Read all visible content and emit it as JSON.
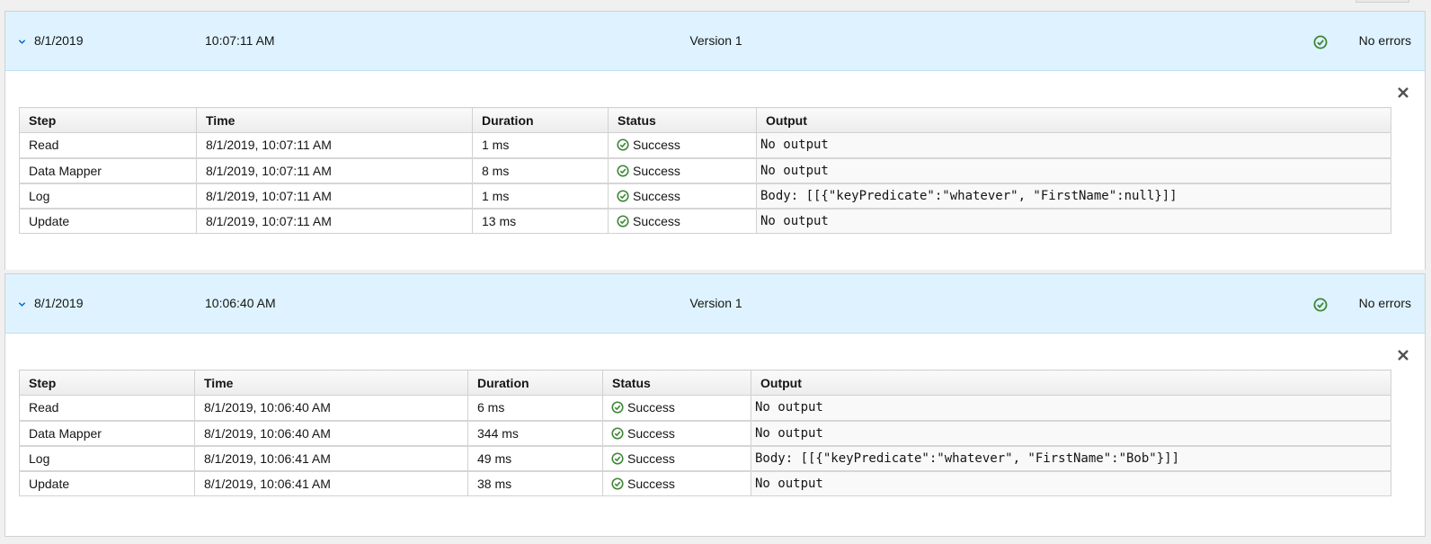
{
  "runs": [
    {
      "date": "8/1/2019",
      "time": "10:07:11 AM",
      "version": "Version 1",
      "status": "No errors",
      "columns": [
        "Step",
        "Time",
        "Duration",
        "Status",
        "Output"
      ],
      "steps": [
        {
          "step": "Read",
          "time": "8/1/2019, 10:07:11 AM",
          "duration": "1 ms",
          "status": "Success",
          "output": "No output"
        },
        {
          "step": "Data Mapper",
          "time": "8/1/2019, 10:07:11 AM",
          "duration": "8 ms",
          "status": "Success",
          "output": "No output"
        },
        {
          "step": "Log",
          "time": "8/1/2019, 10:07:11 AM",
          "duration": "1 ms",
          "status": "Success",
          "output": "Body: [[{\"keyPredicate\":\"whatever\", \"FirstName\":null}]]"
        },
        {
          "step": "Update",
          "time": "8/1/2019, 10:07:11 AM",
          "duration": "13 ms",
          "status": "Success",
          "output": "No output"
        }
      ]
    },
    {
      "date": "8/1/2019",
      "time": "10:06:40 AM",
      "version": "Version 1",
      "status": "No errors",
      "columns": [
        "Step",
        "Time",
        "Duration",
        "Status",
        "Output"
      ],
      "steps": [
        {
          "step": "Read",
          "time": "8/1/2019, 10:06:40 AM",
          "duration": "6 ms",
          "status": "Success",
          "output": "No output"
        },
        {
          "step": "Data Mapper",
          "time": "8/1/2019, 10:06:40 AM",
          "duration": "344 ms",
          "status": "Success",
          "output": "No output"
        },
        {
          "step": "Log",
          "time": "8/1/2019, 10:06:41 AM",
          "duration": "49 ms",
          "status": "Success",
          "output": "Body: [[{\"keyPredicate\":\"whatever\", \"FirstName\":\"Bob\"}]]"
        },
        {
          "step": "Update",
          "time": "8/1/2019, 10:06:41 AM",
          "duration": "38 ms",
          "status": "Success",
          "output": "No output"
        }
      ]
    }
  ],
  "icons": {
    "expand": "chevron-down-icon",
    "status": "check-circle-icon",
    "close": "close-icon"
  },
  "colors": {
    "header_bg": "#def3ff",
    "success": "#3e8635",
    "accent": "#0066cc"
  }
}
